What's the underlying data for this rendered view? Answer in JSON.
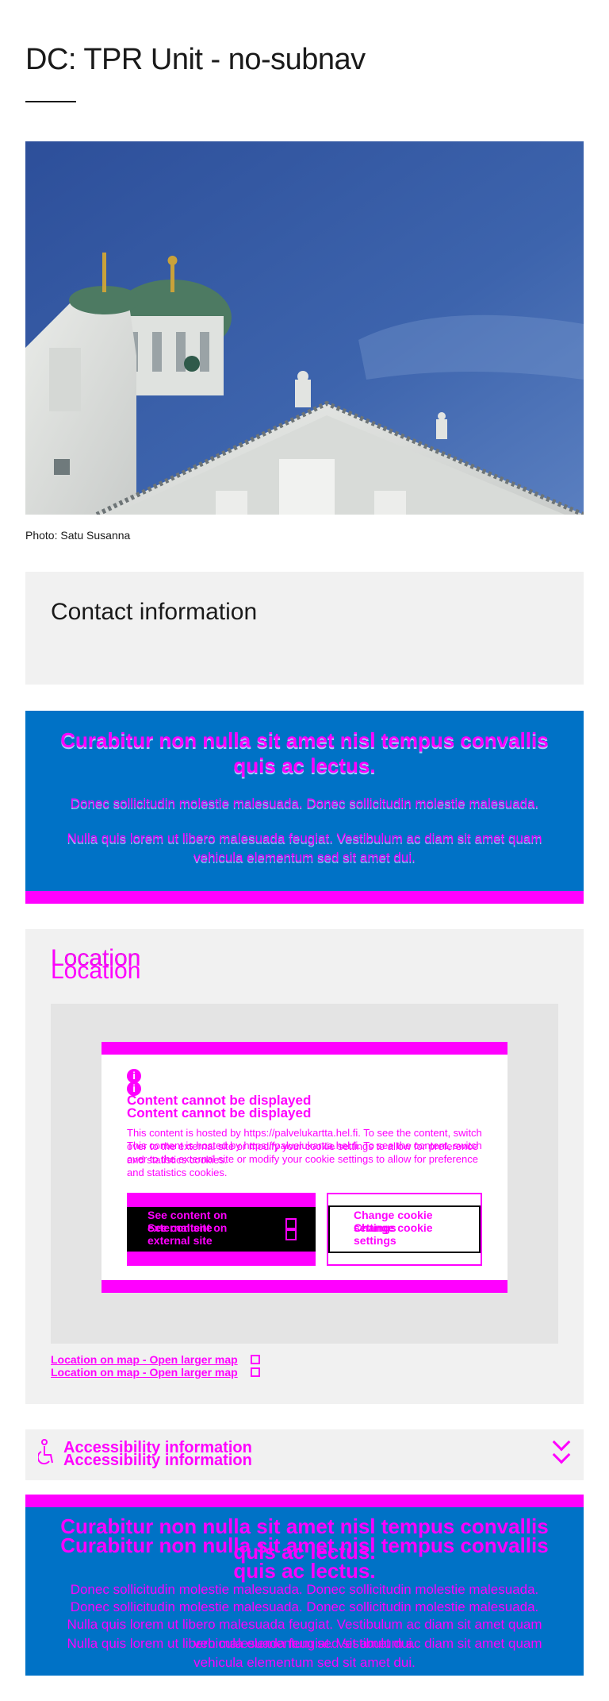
{
  "page": {
    "title": "DC: TPR Unit - no-subnav",
    "photo_caption": "Photo: Satu Susanna"
  },
  "contact": {
    "heading": "Contact information"
  },
  "banner": {
    "title": "Curabitur non nulla sit amet nisl tempus convallis quis ac lectus.",
    "text_1": "Donec sollicitudin molestie malesuada. Donec sollicitudin molestie malesuada.",
    "text_2": "Nulla quis lorem ut libero malesuada feugiat. Vestibulum ac diam sit amet quam vehicula elementum sed sit amet dui."
  },
  "location": {
    "heading": "Location",
    "consent": {
      "title": "Content cannot be displayed",
      "text": "This content is hosted by https://palvelukartta.hel.fi. To see the content, switch over to the external site or modify your cookie settings to allow for preference and statistics cookies.",
      "see_button": "See content on external site",
      "cookie_button": "Change cookie settings"
    },
    "map_link": "Location on map - Open larger map"
  },
  "accessibility": {
    "label": "Accessibility information"
  },
  "colors": {
    "banner_blue": "#0072c6",
    "highlight_magenta": "#ff00ff",
    "panel_gray": "#f1f1f1"
  }
}
